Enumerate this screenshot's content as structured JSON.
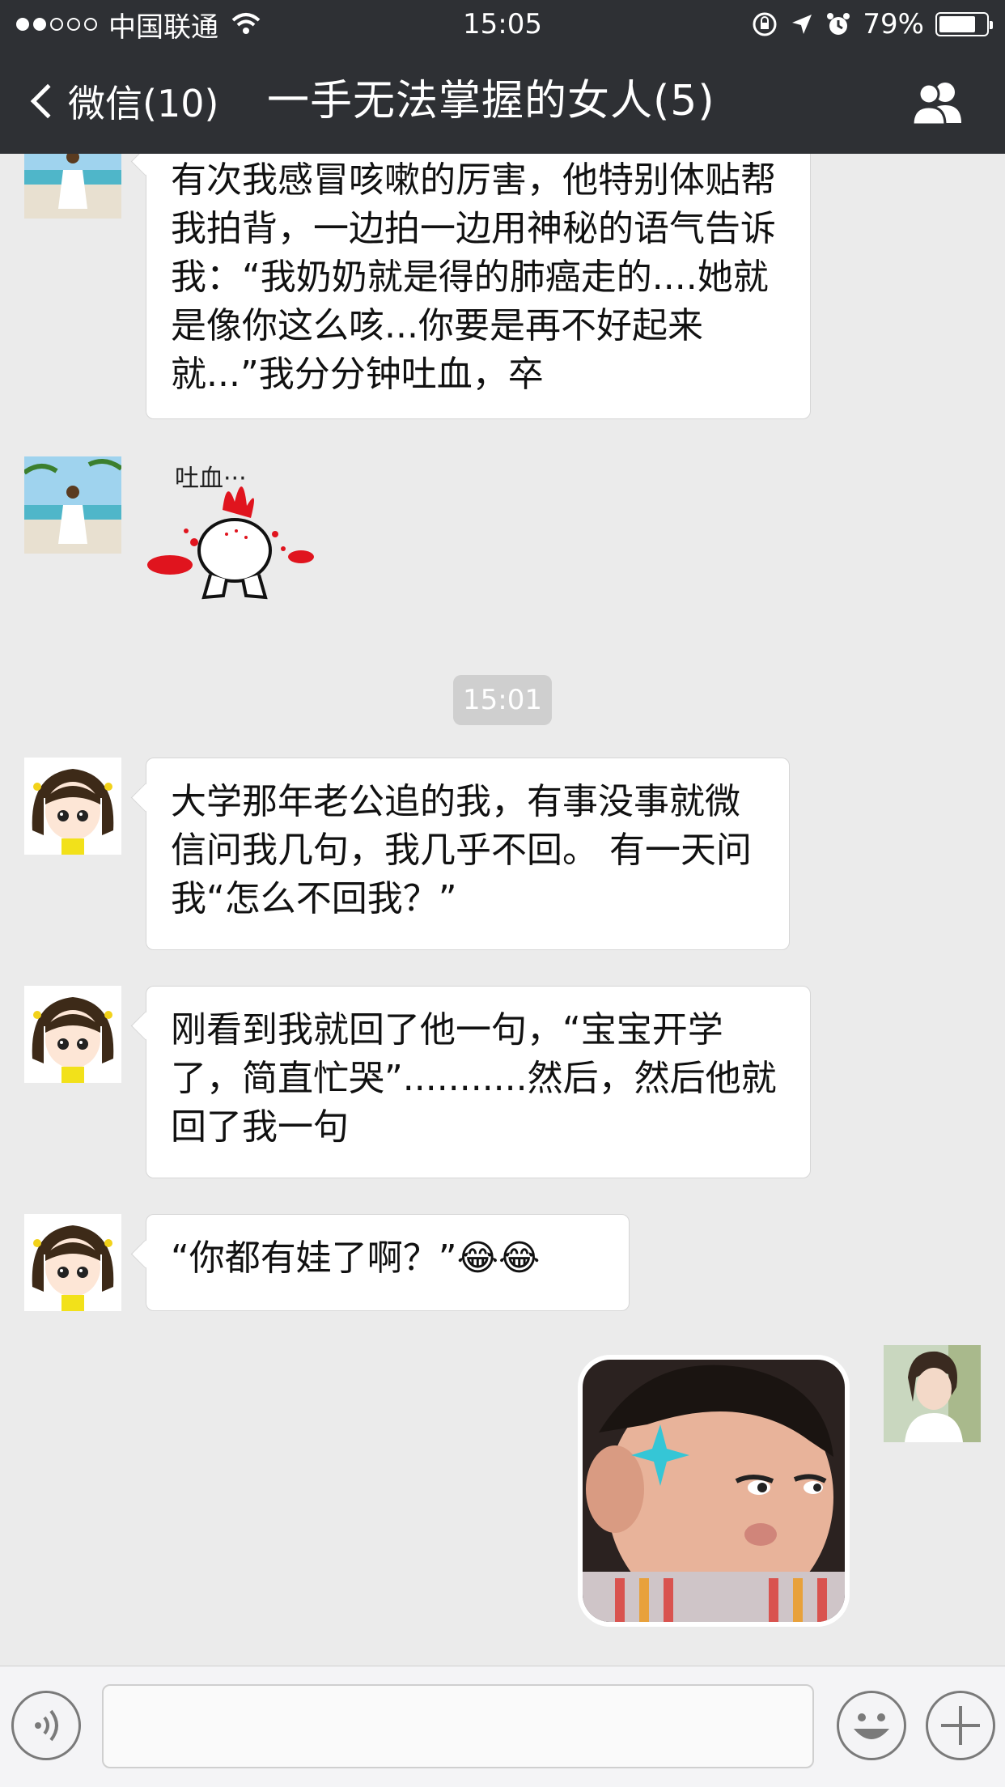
{
  "status_bar": {
    "carrier": "中国联通",
    "time": "15:05",
    "battery_percent": "79%",
    "battery_level": 0.79,
    "signal_bars_filled": 2,
    "signal_bars_total": 5
  },
  "nav": {
    "back_label": "微信(10)",
    "title": "一手无法掌握的女人(5)"
  },
  "messages": [
    {
      "sender": "friend",
      "text": "有次我感冒咳嗽的厉害，他特别体贴帮我拍背，一边拍一边用神秘的语气告诉我：“我奶奶就是得的肺癌走的....她就是像你这么咳...你要是再不好起来就...”我分分钟吐血，卒"
    },
    {
      "sender": "friend",
      "sticker_text": "吐血···"
    },
    {
      "time": "15:01"
    },
    {
      "sender": "cartoon-girl",
      "text": "大学那年老公追的我，有事没事就微信问我几句，我几乎不回。 有一天问我“怎么不回我？”"
    },
    {
      "sender": "cartoon-girl",
      "text": "刚看到我就回了他一句，“宝宝开学了，简直忙哭”...........然后，然后他就回了我一句"
    },
    {
      "sender": "cartoon-girl",
      "text": "“你都有娃了啊？”😂😂"
    },
    {
      "sender": "me",
      "sticker": "boy-face-sticker"
    }
  ],
  "colors": {
    "header_bg": "#2e3034",
    "chat_bg": "#ebebeb",
    "bubble_bg": "#ffffff",
    "time_badge_bg": "#cfcfcf",
    "blood_red": "#e0141e"
  },
  "icons": [
    "chevron-left-icon",
    "wifi-icon",
    "lock-rotation-icon",
    "location-arrow-icon",
    "alarm-icon",
    "battery-icon",
    "contacts-icon",
    "voice-icon",
    "emoji-icon",
    "plus-icon"
  ]
}
